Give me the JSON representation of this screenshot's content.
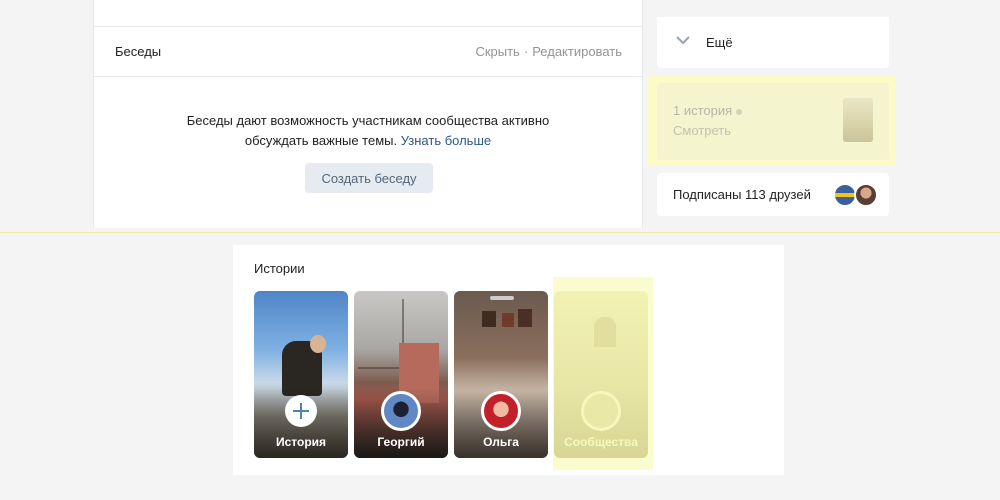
{
  "conversations": {
    "title": "Беседы",
    "hide_label": "Скрыть",
    "separator": "·",
    "edit_label": "Редактировать",
    "description_line1": "Беседы дают возможность участникам сообщества активно",
    "description_line2": "обсуждать важные темы.",
    "learn_more": "Узнать больше",
    "create_button": "Создать беседу"
  },
  "sidebar": {
    "more_label": "Ещё",
    "story_count": "1 история",
    "watch_label": "Смотреть",
    "friends_subscribed": "Подписаны 113 друзей"
  },
  "stories": {
    "title": "Истории",
    "items": [
      {
        "label": "История",
        "kind": "add"
      },
      {
        "label": "Георгий",
        "kind": "user"
      },
      {
        "label": "Ольга",
        "kind": "user"
      },
      {
        "label": "Сообщества",
        "kind": "community"
      }
    ]
  },
  "colors": {
    "link": "#2a5885",
    "button_bg": "#e5ebf1",
    "button_text": "#55677d",
    "highlight": "#fbfbc8"
  }
}
